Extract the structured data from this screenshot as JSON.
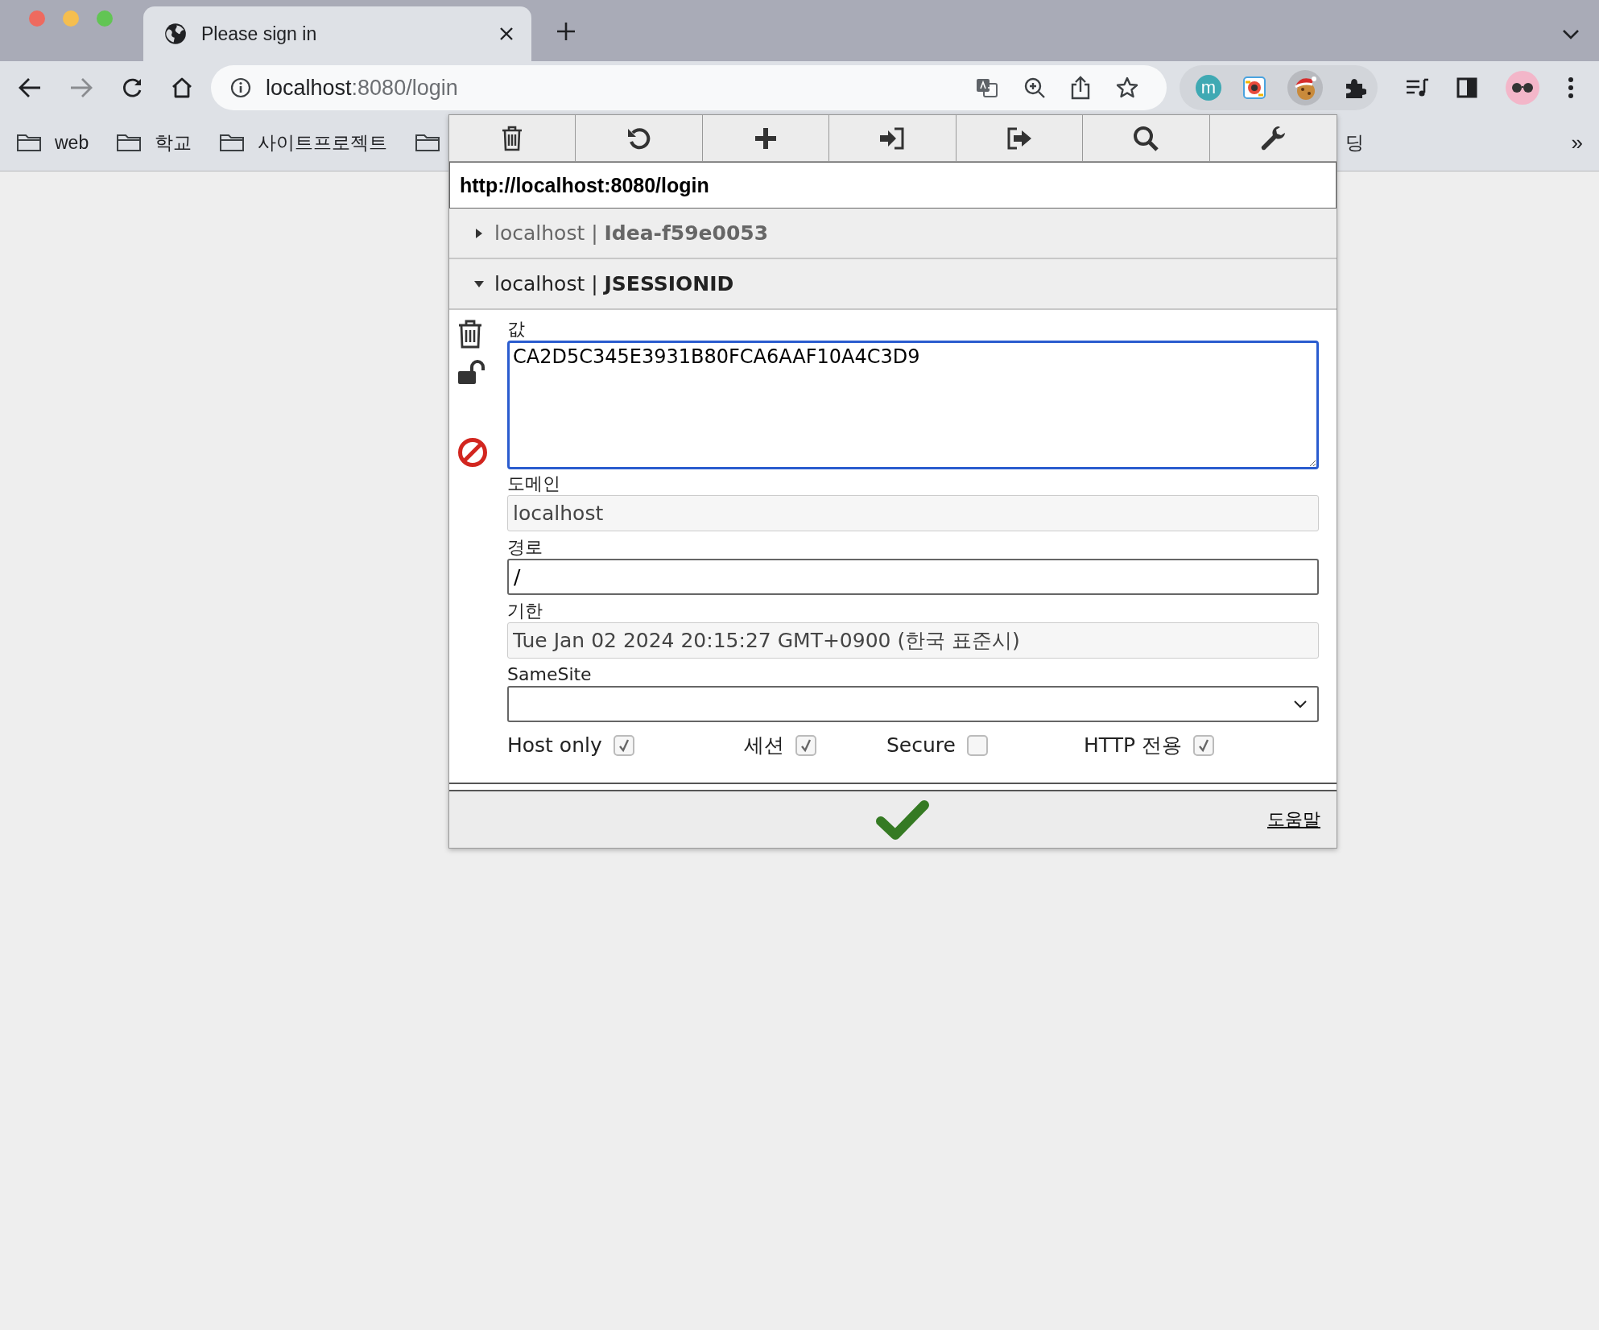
{
  "browser": {
    "tab": {
      "title": "Please sign in"
    },
    "address": {
      "host": "localhost",
      "rest": ":8080/login"
    },
    "extension_letter": "m",
    "bookmarks": [
      {
        "label": "web"
      },
      {
        "label": "학교"
      },
      {
        "label": "사이트프로젝트"
      }
    ],
    "bookmark_fragment": "딩",
    "bookmark_overflow": "»"
  },
  "popup": {
    "url": "http://localhost:8080/login",
    "cookies": [
      {
        "domain": "localhost",
        "separator": "|",
        "name": "Idea-f59e0053",
        "expanded": false
      },
      {
        "domain": "localhost",
        "separator": "|",
        "name": "JSESSIONID",
        "expanded": true
      }
    ],
    "fields": [
      {
        "label": "값",
        "kind": "textarea",
        "value": "CA2D5C345E3931B80FCA6AAF10A4C3D9",
        "focused": true
      },
      {
        "label": "도메인",
        "kind": "text",
        "value": "localhost",
        "readonly": true
      },
      {
        "label": "경로",
        "kind": "text",
        "value": "/",
        "readonly": false
      },
      {
        "label": "기한",
        "kind": "text",
        "value": "Tue Jan 02 2024 20:15:27 GMT+0900 (한국 표준시)",
        "readonly": true
      },
      {
        "label": "SameSite",
        "kind": "select"
      }
    ],
    "flags": [
      {
        "label": "Host only",
        "checked": true
      },
      {
        "label": "세션",
        "checked": true
      },
      {
        "label": "Secure",
        "checked": false
      },
      {
        "label": "HTTP 전용",
        "checked": true
      }
    ],
    "help": "도움말"
  }
}
